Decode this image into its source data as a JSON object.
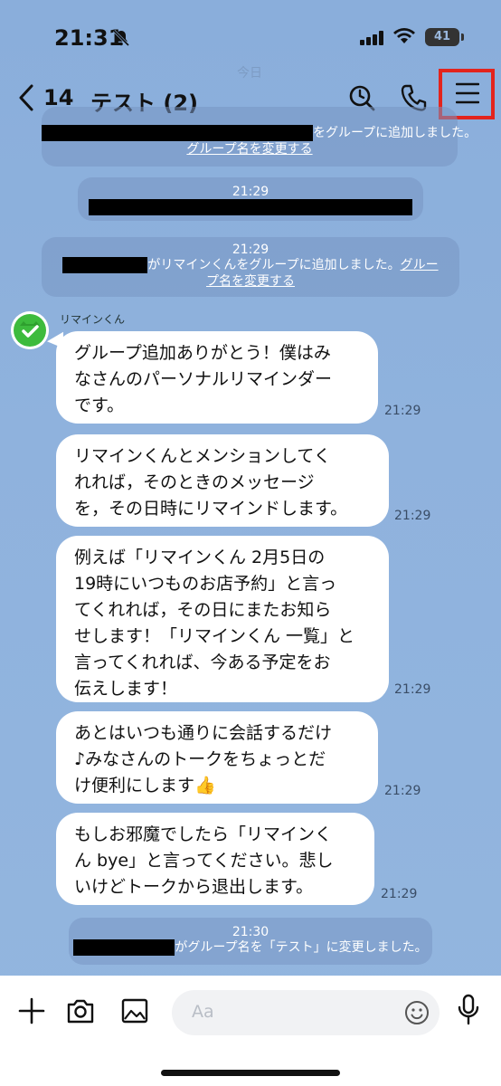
{
  "status_bar": {
    "time": "21:31",
    "battery": "41"
  },
  "header": {
    "date_ghost": "今日",
    "back_count": "14",
    "title": "テスト (2)"
  },
  "notices": [
    {
      "time": "21:29",
      "text": "をグループに追加しました。",
      "link": "グループ名を変更する"
    },
    {
      "time": "21:29"
    },
    {
      "time": "21:29",
      "text": "がリマインくんをグループに追加しました。",
      "link_part1": "グルー",
      "link_part2": "プ名を変更する"
    },
    {
      "time": "21:30",
      "text": "がグループ名を「テスト」に変更しました。"
    }
  ],
  "bot": {
    "name": "リマインくん"
  },
  "messages": [
    {
      "lines": [
        "グループ追加ありがとう！僕はみ",
        "なさんのパーソナルリマインダー",
        "です。"
      ],
      "time": "21:29"
    },
    {
      "lines": [
        "リマインくんとメンションしてく",
        "れれば，そのときのメッセージ",
        "を，その日時にリマインドします。"
      ],
      "time": "21:29"
    },
    {
      "lines": [
        "例えば「リマインくん 2月5日の",
        "19時にいつものお店予約」と言っ",
        "てくれれば，その日にまたお知ら",
        "せします！「リマインくん 一覧」と",
        "言ってくれれば、今ある予定をお",
        "伝えします！"
      ],
      "time": "21:29"
    },
    {
      "lines": [
        "あとはいつも通りに会話するだけ",
        "♪みなさんのトークをちょっとだ",
        "け便利にします"
      ],
      "emoji": "👍",
      "time": "21:29"
    },
    {
      "lines": [
        "もしお邪魔でしたら「リマインく",
        "ん bye」と言ってください。悲し",
        "いけどトークから退出します。"
      ],
      "time": "21:29"
    }
  ],
  "input": {
    "placeholder": "Aa"
  },
  "colors": {
    "highlight": "#e3241d",
    "bot_avatar": "#3dbb3d"
  }
}
